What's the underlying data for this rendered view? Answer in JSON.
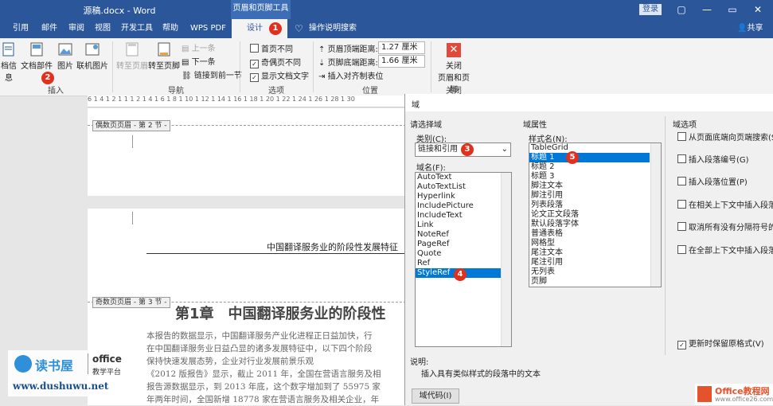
{
  "window": {
    "title": "源稿.docx - Word",
    "context_tab": "页眉和页脚工具",
    "login": "登录",
    "share": "共享"
  },
  "tabs": [
    "引用",
    "邮件",
    "审阅",
    "视图",
    "开发工具",
    "帮助",
    "WPS PDF",
    "设计",
    "操作说明搜索"
  ],
  "ribbon": {
    "insert_group": {
      "items": [
        "档信息",
        "文档部件",
        "图片",
        "联机图片"
      ],
      "label": "插入"
    },
    "nav_group": {
      "goto_header": "转至页眉",
      "goto_footer": "转至页脚",
      "prev": "上一条",
      "next": "下一条",
      "link_prev": "链接到前一节",
      "label": "导航"
    },
    "options_group": {
      "first_page": "首页不同",
      "odd_even": "奇偶页不同",
      "show_text": "显示文档文字",
      "label": "选项"
    },
    "position_group": {
      "header_top": "页眉顶端距离:",
      "header_top_value": "1.27 厘米",
      "footer_bottom": "页脚底端距离:",
      "footer_bottom_value": "1.66 厘米",
      "insert_tab": "插入对齐制表位",
      "label": "位置"
    },
    "close_group": {
      "close": "关闭",
      "close2": "页眉和页脚",
      "label": "关闭"
    }
  },
  "ruler": "6 1 4 1 2 1 1 1 2 1 4 1 6 1 8 1 10 1 12 1 14 1 16 1 18 1 20 1 22 1 24 1 26 1 28 1 30",
  "document": {
    "even_header_tag": "偶数页页眉 - 第 2 节 -",
    "odd_header_tag": "奇数页页眉 - 第 3 节 -",
    "header_text": "中国翻译服务业的阶段性发展特征",
    "chapter_title": "第1章　中国翻译服务业的阶段性",
    "body_lines": [
      "本报告的数据显示，中国翻译服务产业化进程正日益加快，行",
      "在中国翻译服务业日益凸显的诸多发展特征中，以下四个阶段",
      "保持快速发展态势，企业对行业发展前景乐观",
      "《2012 版报告》显示，截止 2011 年，全国在营语言服务及相",
      "报告源数据显示，到 2013 年底，这个数字增加到了 55975 家",
      "年两年时间，全国新增 18778 家在营语言服务及相关企业，年"
    ]
  },
  "dialog": {
    "title": "域",
    "choose_field": "请选择域",
    "category_label": "类别(C):",
    "category_value": "链接和引用",
    "field_names_label": "域名(F):",
    "field_names": [
      "AutoText",
      "AutoTextList",
      "Hyperlink",
      "IncludePicture",
      "IncludeText",
      "Link",
      "NoteRef",
      "PageRef",
      "Quote",
      "Ref",
      "StyleRef"
    ],
    "field_props": "域属性",
    "style_name_label": "样式名(N):",
    "style_names": [
      "TableGrid",
      "标题 1",
      "标题 2",
      "标题 3",
      "脚注文本",
      "脚注引用",
      "列表段落",
      "论文正文段落",
      "默认段落字体",
      "普通表格",
      "网格型",
      "尾注文本",
      "尾注引用",
      "无列表",
      "页脚"
    ],
    "field_options": "域选项",
    "options": [
      "从页面底端向页端搜索(S)",
      "插入段落编号(G)",
      "插入段落位置(P)",
      "在相关上下文中插入段落号",
      "取消所有没有分隔符号的字",
      "在全部上下文中插入段落号"
    ],
    "preserve_format": "更新时保留原格式(V)",
    "description_label": "说明:",
    "description": "插入具有类似样式的段落中的文本",
    "field_codes_button": "域代码(I)"
  },
  "badges": [
    "1",
    "2",
    "3",
    "4",
    "5"
  ],
  "watermarks": {
    "site_name": "读书屋",
    "office": "office",
    "platform": "教学平台",
    "url": "www.dushuwu.net",
    "office_logo": "Office教程网",
    "office_url": "www.office26.com"
  }
}
